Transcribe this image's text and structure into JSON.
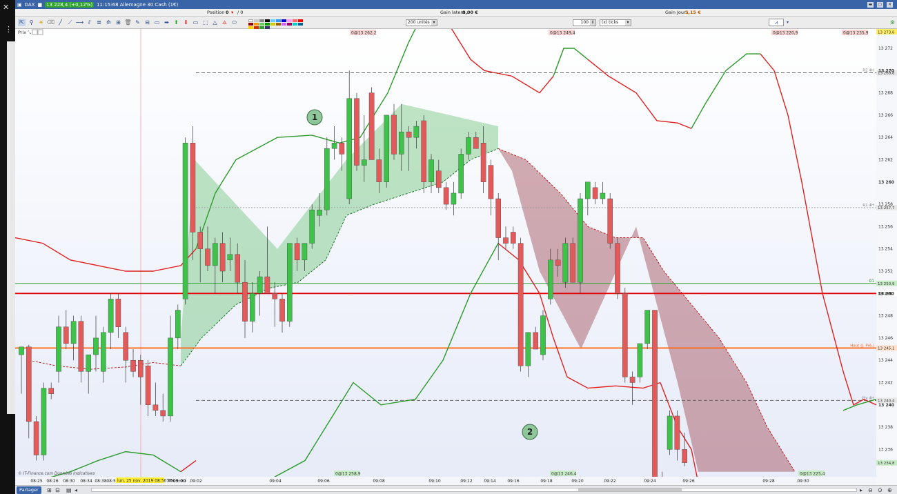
{
  "window": {
    "instrument": "DAX",
    "price_badge": "13 228,4 (+0,12%)",
    "title_rest": "11:15:68 Allemagne 30 Cash (1€)"
  },
  "infobar": {
    "position_label": "Position :",
    "position_value": "0",
    "position_sep": "/ 0",
    "gain_latent_label": "Gain latent :",
    "gain_latent_value": "0,00 €",
    "gain_jour_label": "Gain Jour :",
    "gain_jour_value": "5,15 €"
  },
  "toolbar": {
    "units_select": "200 unités",
    "ticks_value": "100",
    "ticks_select": "(x) ticks"
  },
  "chart_tab": "Prix",
  "colors": {
    "up_candle": "#3ec24a",
    "down_candle": "#e35a5a",
    "bollinger_up": "#2a9a2a",
    "bollinger_down": "#e02020",
    "line_13250": "#e00000",
    "line_haut": "#ff6a1a",
    "line_r1": "#2aa02a",
    "price_axis_label_bg": "#fbd3d3"
  },
  "axis": {
    "y_ticks": [
      "13 272",
      "13 270",
      "13 268",
      "13 266",
      "13 264",
      "13 262",
      "13 260",
      "13 258",
      "13 256",
      "13 254",
      "13 252",
      "13 250",
      "13 248",
      "13 246",
      "13 244",
      "13 242",
      "13 240",
      "13 238",
      "13 236"
    ],
    "x_ticks": [
      "08:25",
      "08:26",
      "08:30",
      "08:34",
      "08:38",
      "08:58",
      "09:00",
      "09:02",
      "09:04",
      "09:06",
      "09:08",
      "09:10",
      "09:12",
      "09:14",
      "09:16",
      "09:18",
      "09:20",
      "09:22",
      "09:24",
      "09:26",
      "09:28",
      "09:30"
    ],
    "cursor_time": "lun. 25 nov. 2019 08:50:45",
    "cursor_time_suffix": "56"
  },
  "levels": {
    "r2_label": "R2 4H",
    "r2_value": "13 269,8",
    "r1_4h_label": "R1 4H",
    "r1_4h_value": "13 257,7",
    "r1_label": "R1",
    "r1_value": "13 250,9",
    "line13250_value": "13 250",
    "haut_label": "Haut (J. Pré.)",
    "haut_value": "13 245,1",
    "piv_label": "Piv 4H",
    "piv_value": "13 240,4",
    "last_value": "13 234,8",
    "top_value": "13 273,6"
  },
  "top_labels": [
    "0@13 262,2",
    "0@13 249,4",
    "0@13 220,9",
    "0@13 235,9"
  ],
  "bottom_labels": [
    "0@13 258,9",
    "0@13 246,4",
    "0@13 225,4"
  ],
  "markers": [
    "1",
    "2"
  ],
  "footer_text": "© IT-Finance.com  Données indicatives",
  "statusbar": {
    "share": "Partager"
  },
  "chart_data": {
    "type": "candlestick",
    "x_time_range": [
      "08:25",
      "09:32"
    ],
    "ylim": [
      13234.5,
      13273.6
    ],
    "candles": [
      {
        "o": 13244.5,
        "h": 13245.2,
        "l": 13241,
        "c": 13245.2
      },
      {
        "o": 13245.2,
        "h": 13245.4,
        "l": 13237,
        "c": 13238.5
      },
      {
        "o": 13238.5,
        "h": 13239,
        "l": 13235,
        "c": 13235.5
      },
      {
        "o": 13235.5,
        "h": 13242,
        "l": 13235,
        "c": 13241.5
      },
      {
        "o": 13241.5,
        "h": 13242,
        "l": 13240.5,
        "c": 13241
      },
      {
        "o": 13243,
        "h": 13248,
        "l": 13242,
        "c": 13247
      },
      {
        "o": 13247,
        "h": 13248.5,
        "l": 13245,
        "c": 13245.5
      },
      {
        "o": 13245.5,
        "h": 13248,
        "l": 13244,
        "c": 13247.5
      },
      {
        "o": 13247.5,
        "h": 13248,
        "l": 13242,
        "c": 13243
      },
      {
        "o": 13243,
        "h": 13244,
        "l": 13241,
        "c": 13244.5
      },
      {
        "o": 13244.5,
        "h": 13248,
        "l": 13243,
        "c": 13246
      },
      {
        "o": 13243,
        "h": 13247,
        "l": 13242,
        "c": 13246.5
      },
      {
        "o": 13246.5,
        "h": 13250,
        "l": 13245,
        "c": 13249.5
      },
      {
        "o": 13249.5,
        "h": 13250,
        "l": 13246,
        "c": 13247
      },
      {
        "o": 13246.5,
        "h": 13247,
        "l": 13242,
        "c": 13244
      },
      {
        "o": 13244,
        "h": 13245,
        "l": 13242.5,
        "c": 13243
      },
      {
        "o": 13244,
        "h": 13244.5,
        "l": 13240,
        "c": 13242.5
      },
      {
        "o": 13243.5,
        "h": 13244,
        "l": 13239,
        "c": 13240
      },
      {
        "o": 13240,
        "h": 13242,
        "l": 13239,
        "c": 13239.5
      },
      {
        "o": 13239.5,
        "h": 13241,
        "l": 13238.5,
        "c": 13239
      },
      {
        "o": 13239,
        "h": 13248,
        "l": 13238.5,
        "c": 13246
      },
      {
        "o": 13246,
        "h": 13249,
        "l": 13245,
        "c": 13248.5
      },
      {
        "o": 13249.5,
        "h": 13264,
        "l": 13249,
        "c": 13263.5
      },
      {
        "o": 13263.5,
        "h": 13265,
        "l": 13253,
        "c": 13255.5
      },
      {
        "o": 13255.5,
        "h": 13256,
        "l": 13251,
        "c": 13254
      },
      {
        "o": 13254,
        "h": 13256,
        "l": 13252,
        "c": 13252.5
      },
      {
        "o": 13252.5,
        "h": 13255,
        "l": 13250,
        "c": 13254.5
      },
      {
        "o": 13254.5,
        "h": 13255.5,
        "l": 13251,
        "c": 13252
      },
      {
        "o": 13253,
        "h": 13255,
        "l": 13252,
        "c": 13253.5
      },
      {
        "o": 13253.5,
        "h": 13254.5,
        "l": 13250,
        "c": 13251
      },
      {
        "o": 13251,
        "h": 13253,
        "l": 13246,
        "c": 13247.5
      },
      {
        "o": 13247.5,
        "h": 13251,
        "l": 13246.5,
        "c": 13250
      },
      {
        "o": 13250,
        "h": 13252,
        "l": 13248,
        "c": 13251.5
      },
      {
        "o": 13251.5,
        "h": 13256,
        "l": 13250,
        "c": 13250
      },
      {
        "o": 13250,
        "h": 13251,
        "l": 13247,
        "c": 13249.5
      },
      {
        "o": 13249.5,
        "h": 13250,
        "l": 13246.5,
        "c": 13247.5
      },
      {
        "o": 13247.5,
        "h": 13254,
        "l": 13247,
        "c": 13254.5
      },
      {
        "o": 13254.5,
        "h": 13255,
        "l": 13252,
        "c": 13253
      },
      {
        "o": 13253,
        "h": 13254.5,
        "l": 13252,
        "c": 13254.5
      },
      {
        "o": 13254.5,
        "h": 13258,
        "l": 13254,
        "c": 13257.5
      },
      {
        "o": 13257,
        "h": 13259,
        "l": 13256,
        "c": 13257.5
      },
      {
        "o": 13257.5,
        "h": 13264,
        "l": 13257,
        "c": 13263
      },
      {
        "o": 13263,
        "h": 13265,
        "l": 13262,
        "c": 13263.5
      },
      {
        "o": 13263.5,
        "h": 13264,
        "l": 13261,
        "c": 13262.5
      },
      {
        "o": 13258.5,
        "h": 13270,
        "l": 13258,
        "c": 13267.5
      },
      {
        "o": 13267.5,
        "h": 13268,
        "l": 13261,
        "c": 13261.5
      },
      {
        "o": 13261.5,
        "h": 13266,
        "l": 13260,
        "c": 13262
      },
      {
        "o": 13268,
        "h": 13268.5,
        "l": 13262,
        "c": 13262
      },
      {
        "o": 13262,
        "h": 13263,
        "l": 13259,
        "c": 13260
      },
      {
        "o": 13260,
        "h": 13266,
        "l": 13259.5,
        "c": 13266
      },
      {
        "o": 13266,
        "h": 13267,
        "l": 13262,
        "c": 13262.5
      },
      {
        "o": 13262.5,
        "h": 13267,
        "l": 13261,
        "c": 13264.5
      },
      {
        "o": 13264.5,
        "h": 13265,
        "l": 13261,
        "c": 13264
      },
      {
        "o": 13264,
        "h": 13265.5,
        "l": 13263,
        "c": 13265
      },
      {
        "o": 13265.5,
        "h": 13266,
        "l": 13259,
        "c": 13260
      },
      {
        "o": 13260,
        "h": 13262.5,
        "l": 13259,
        "c": 13262
      },
      {
        "o": 13261,
        "h": 13262,
        "l": 13259,
        "c": 13259.5
      },
      {
        "o": 13259.5,
        "h": 13260,
        "l": 13257.5,
        "c": 13258
      },
      {
        "o": 13258,
        "h": 13260,
        "l": 13257,
        "c": 13259
      },
      {
        "o": 13259,
        "h": 13263,
        "l": 13258.5,
        "c": 13262.5
      },
      {
        "o": 13262.5,
        "h": 13264.5,
        "l": 13262,
        "c": 13264
      },
      {
        "o": 13264,
        "h": 13264.5,
        "l": 13263,
        "c": 13263
      },
      {
        "o": 13263.5,
        "h": 13265,
        "l": 13259,
        "c": 13260
      },
      {
        "o": 13261.5,
        "h": 13262,
        "l": 13257,
        "c": 13258.5
      },
      {
        "o": 13258.5,
        "h": 13259,
        "l": 13253,
        "c": 13255
      },
      {
        "o": 13255,
        "h": 13256,
        "l": 13254,
        "c": 13254.5
      },
      {
        "o": 13255.5,
        "h": 13256,
        "l": 13254,
        "c": 13254.5
      },
      {
        "o": 13254.5,
        "h": 13255,
        "l": 13243,
        "c": 13243.5
      },
      {
        "o": 13243.5,
        "h": 13246.5,
        "l": 13242.5,
        "c": 13246.5
      },
      {
        "o": 13246.5,
        "h": 13247,
        "l": 13245,
        "c": 13245
      },
      {
        "o": 13244.5,
        "h": 13248.5,
        "l": 13244,
        "c": 13248
      },
      {
        "o": 13249.5,
        "h": 13254,
        "l": 13249,
        "c": 13253
      },
      {
        "o": 13253,
        "h": 13254,
        "l": 13251.5,
        "c": 13252.5
      },
      {
        "o": 13251,
        "h": 13255,
        "l": 13250.5,
        "c": 13254.5
      },
      {
        "o": 13254.5,
        "h": 13255,
        "l": 13251,
        "c": 13251
      },
      {
        "o": 13251,
        "h": 13259,
        "l": 13250,
        "c": 13258.5
      },
      {
        "o": 13258.5,
        "h": 13260,
        "l": 13257,
        "c": 13260
      },
      {
        "o": 13259.5,
        "h": 13260,
        "l": 13258,
        "c": 13258.5
      },
      {
        "o": 13258.5,
        "h": 13260,
        "l": 13258,
        "c": 13259
      },
      {
        "o": 13258.5,
        "h": 13259,
        "l": 13254,
        "c": 13254.5
      },
      {
        "o": 13254.5,
        "h": 13255,
        "l": 13249.5,
        "c": 13250
      },
      {
        "o": 13250,
        "h": 13250.5,
        "l": 13242,
        "c": 13242.5
      },
      {
        "o": 13242.5,
        "h": 13243,
        "l": 13240,
        "c": 13242
      },
      {
        "o": 13242.5,
        "h": 13245,
        "l": 13242,
        "c": 13245.5
      },
      {
        "o": 13245.5,
        "h": 13248,
        "l": 13245,
        "c": 13248.5
      },
      {
        "o": 13248.5,
        "h": 13248.5,
        "l": 13233,
        "c": 13233.5
      },
      {
        "o": 13233.5,
        "h": 13234,
        "l": 13233,
        "c": 13233.5
      },
      {
        "o": 13236,
        "h": 13239.5,
        "l": 13235.5,
        "c": 13239
      },
      {
        "o": 13239,
        "h": 13239.5,
        "l": 13235,
        "c": 13236
      },
      {
        "o": 13236,
        "h": 13237.5,
        "l": 13234.5,
        "c": 13234.8
      }
    ]
  }
}
